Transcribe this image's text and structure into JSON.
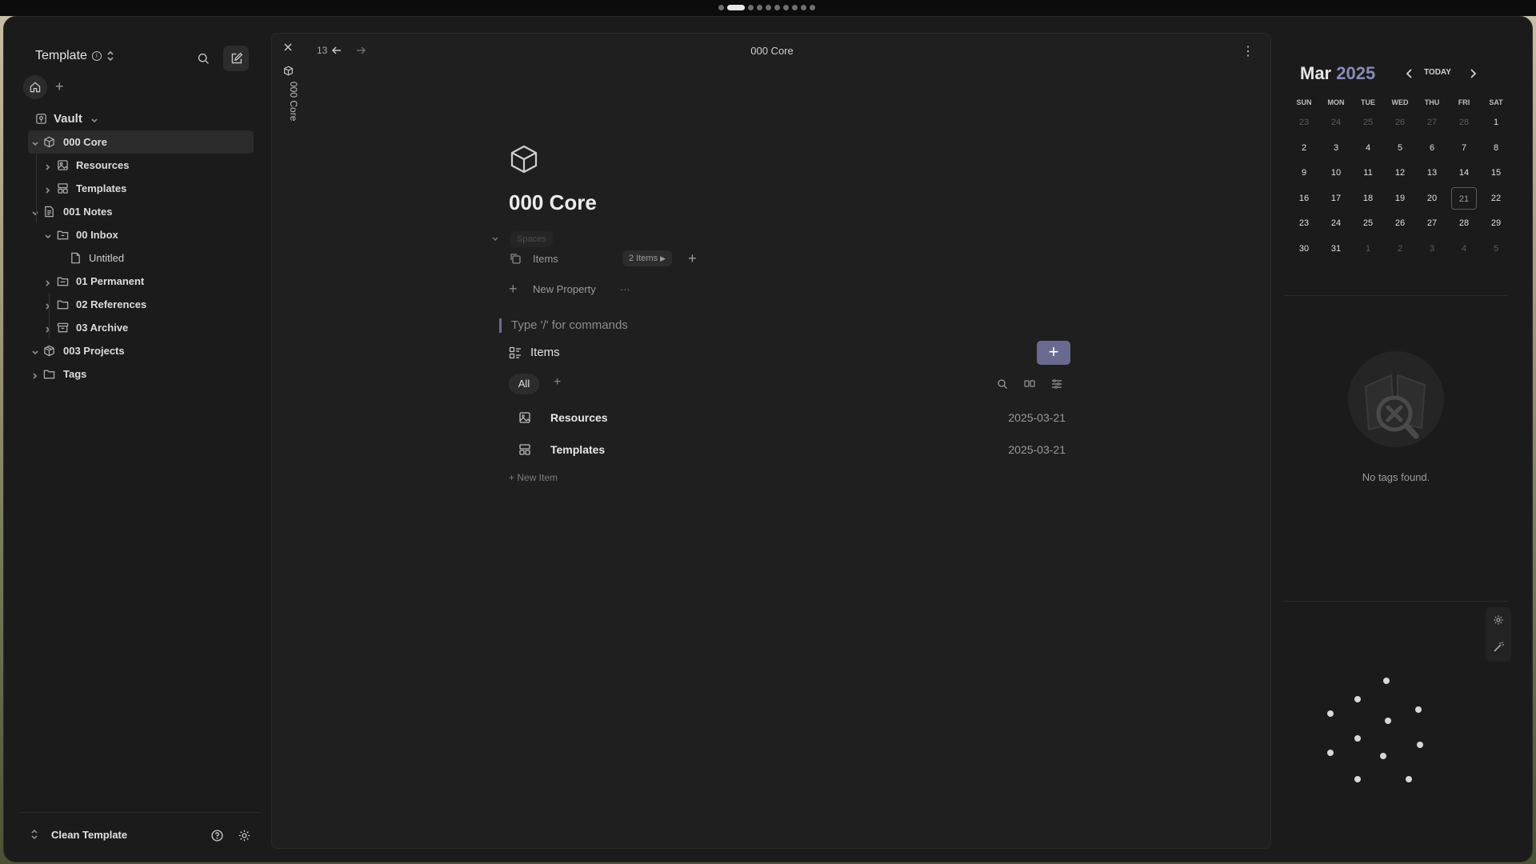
{
  "sidebar": {
    "workspace_title": "Template",
    "tree": [
      {
        "label": "Vault"
      },
      {
        "label": "000 Core"
      },
      {
        "label": "Resources"
      },
      {
        "label": "Templates"
      },
      {
        "label": "001 Notes"
      },
      {
        "label": "00 Inbox"
      },
      {
        "label": "Untitled"
      },
      {
        "label": "01 Permanent"
      },
      {
        "label": "02 References"
      },
      {
        "label": "03 Archive"
      },
      {
        "label": "003 Projects"
      },
      {
        "label": "Tags"
      }
    ],
    "footer_label": "Clean Template"
  },
  "main": {
    "vertical_tab_title": "000 Core",
    "nav_count": "13",
    "breadcrumb": "000 Core",
    "page_title": "000 Core",
    "properties": {
      "spaces_label": "Spaces",
      "items_label": "Items",
      "items_value": "2 Items",
      "new_property_label": "New Property"
    },
    "command_hint": "Type '/' for commands",
    "items_section": {
      "title": "Items",
      "filter_all": "All",
      "rows": [
        {
          "name": "Resources",
          "date": "2025-03-21",
          "icon": "image-icon"
        },
        {
          "name": "Templates",
          "date": "2025-03-21",
          "icon": "layout-icon"
        }
      ],
      "new_item_label": "+ New Item"
    }
  },
  "calendar": {
    "month": "Mar",
    "year": "2025",
    "today_label": "TODAY",
    "weekdays": [
      "SUN",
      "MON",
      "TUE",
      "WED",
      "THU",
      "FRI",
      "SAT"
    ],
    "days": [
      [
        "23",
        "24",
        "25",
        "26",
        "27",
        "28",
        "1"
      ],
      [
        "2",
        "3",
        "4",
        "5",
        "6",
        "7",
        "8"
      ],
      [
        "9",
        "10",
        "11",
        "12",
        "13",
        "14",
        "15"
      ],
      [
        "16",
        "17",
        "18",
        "19",
        "20",
        "21",
        "22"
      ],
      [
        "23",
        "24",
        "25",
        "26",
        "27",
        "28",
        "29"
      ],
      [
        "30",
        "31",
        "1",
        "2",
        "3",
        "4",
        "5"
      ]
    ],
    "today_day": "21"
  },
  "tags_panel": {
    "empty_message": "No tags found."
  },
  "colors": {
    "accent": "#6a6a90",
    "year_accent": "#8a8ab8",
    "background": "#1b1b1b"
  }
}
